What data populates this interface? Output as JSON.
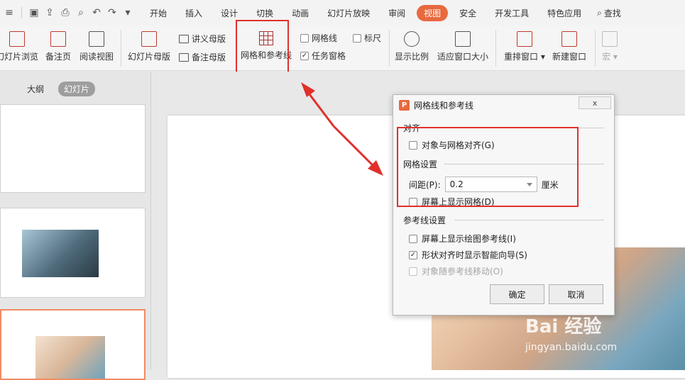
{
  "menubar": {
    "tabs": [
      "开始",
      "插入",
      "设计",
      "切换",
      "动画",
      "幻灯片放映",
      "审阅",
      "视图",
      "安全",
      "开发工具",
      "特色应用"
    ],
    "active_tab": "视图",
    "search_label": "查找"
  },
  "ribbon": {
    "slide_browse": "幻灯片浏览",
    "notes_page": "备注页",
    "reading_view": "阅读视图",
    "slide_master": "幻灯片母版",
    "handout_master": "讲义母版",
    "notes_master": "备注母版",
    "grid_guides": "网格和参考线",
    "gridlines": "网格线",
    "ruler": "标尺",
    "task_pane": "任务窗格",
    "zoom_ratio": "显示比例",
    "fit_window": "适应窗口大小",
    "arrange_windows": "重排窗口",
    "new_window": "新建窗口",
    "macro": "宏"
  },
  "left_panel": {
    "outline_tab": "大纲",
    "slides_tab": "幻灯片"
  },
  "dialog": {
    "title": "网格线和参考线",
    "close": "x",
    "group_snap": "对齐",
    "snap_to_grid": "对象与网格对齐(G)",
    "group_grid": "网格设置",
    "spacing_label": "间距(P):",
    "spacing_value": "0.2",
    "spacing_unit": "厘米",
    "show_grid": "屏幕上显示网格(D)",
    "group_guides": "参考线设置",
    "show_guides": "屏幕上显示绘图参考线(I)",
    "smart_guides": "形状对齐时显示智能向导(S)",
    "move_with_guides": "对象随参考线移动(O)",
    "ok": "确定",
    "cancel": "取消"
  },
  "watermark": {
    "brand": "Bai 经验",
    "url": "jingyan.baidu.com"
  },
  "colors": {
    "accent": "#e8693e",
    "highlight": "#e0302c"
  }
}
